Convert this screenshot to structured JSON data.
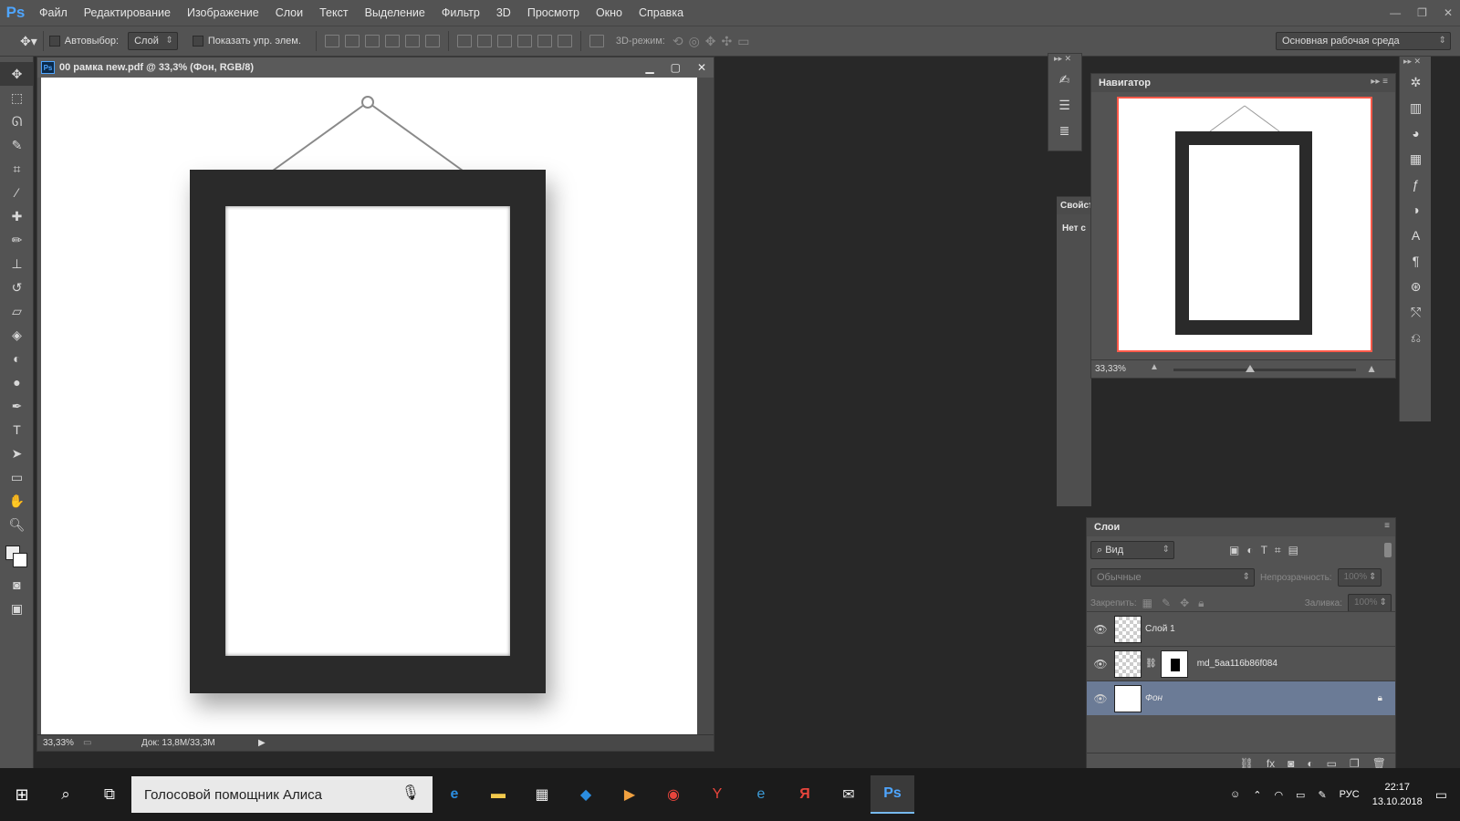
{
  "app": {
    "logo": "Ps",
    "menu": [
      "Файл",
      "Редактирование",
      "Изображение",
      "Слои",
      "Текст",
      "Выделение",
      "Фильтр",
      "3D",
      "Просмотр",
      "Окно",
      "Справка"
    ]
  },
  "options_bar": {
    "autoselect_label": "Автовыбор:",
    "autoselect_value": "Слой",
    "show_transform_label": "Показать упр. элем.",
    "mode_3d_label": "3D-режим:",
    "workspace": "Основная рабочая среда"
  },
  "document": {
    "title": "00 рамка new.pdf @ 33,3% (Фон, RGB/8)",
    "zoom": "33,33%",
    "doc_info": "Док: 13,8M/33,3M"
  },
  "properties_panel": {
    "tab_stub": "Свойст",
    "text_stub": "Нет с"
  },
  "navigator": {
    "tab": "Навигатор",
    "zoom": "33,33%",
    "zoom_position": 0.42
  },
  "layers": {
    "tab": "Слои",
    "filter": "Вид",
    "blend_mode": "Обычные",
    "opacity_label": "Непрозрачность:",
    "opacity_value": "100%",
    "lock_label": "Закрепить:",
    "fill_label": "Заливка:",
    "fill_value": "100%",
    "items": [
      {
        "name": "Слой 1",
        "visible": true,
        "selected": false
      },
      {
        "name": "md_5aa116b86f084",
        "visible": true,
        "selected": false
      },
      {
        "name": "Фон",
        "visible": true,
        "selected": true,
        "locked": true
      }
    ]
  },
  "taskbar": {
    "search_text": "Голосовой помощник Алиса",
    "apps": [
      "edge-icon",
      "explorer-icon",
      "store-icon",
      "dropbox-icon",
      "video-icon",
      "chrome-icon",
      "yandex-browser-icon",
      "ie-icon",
      "yandex-icon",
      "mail-icon",
      "photoshop-icon"
    ],
    "lang": "РУС",
    "time": "22:17",
    "date": "13.10.2018"
  },
  "colors": {
    "ui_panel": "#535353",
    "selection": "#6b7b96",
    "ps_accent": "#4ea5ff",
    "navigator_box": "#ff5a4a"
  }
}
